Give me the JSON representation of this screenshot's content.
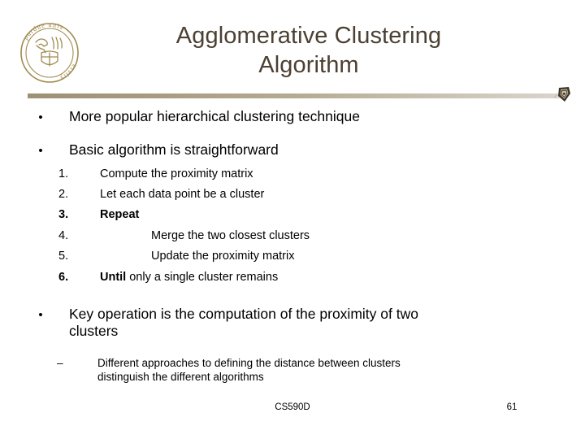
{
  "slide": {
    "title_lines": [
      "Agglomerative Clustering",
      "Algorithm"
    ],
    "title_color": "#4b4032",
    "background_color": "#ffffff",
    "divider_color_left": "#9d9173",
    "divider_color_right": "#d9d5cc"
  },
  "logo": {
    "name": "purdue-university-seal",
    "alt_text": "purdue university",
    "color": "#a08c50"
  },
  "ornament": {
    "name": "shield-ornament",
    "color": "#3b3328"
  },
  "bullets": {
    "b1": {
      "marker": "•",
      "text": "More popular hierarchical clustering technique"
    },
    "b2": {
      "marker": "•",
      "text": "Basic algorithm is straightforward"
    },
    "b3": {
      "marker": "•",
      "line1": "Key operation is the computation of the proximity of two",
      "line2": "clusters"
    },
    "sub1": {
      "marker": "–",
      "line1": "Different approaches to defining the distance between clusters",
      "line2": "distinguish the different algorithms"
    }
  },
  "algorithm_steps": [
    {
      "num": "1.",
      "text": "Compute the proximity matrix",
      "bold_lead": "",
      "deep": false,
      "bold_num": false
    },
    {
      "num": "2.",
      "text": "Let each data point be a cluster",
      "bold_lead": "",
      "deep": false,
      "bold_num": false
    },
    {
      "num": "3.",
      "text": "",
      "bold_lead": "Repeat",
      "deep": false,
      "bold_num": true
    },
    {
      "num": "4.",
      "text": "Merge the two closest clusters",
      "bold_lead": "",
      "deep": true,
      "bold_num": false
    },
    {
      "num": "5.",
      "text": "Update the proximity matrix",
      "bold_lead": "",
      "deep": true,
      "bold_num": false
    },
    {
      "num": "6.",
      "text": " only a single cluster remains",
      "bold_lead": "Until",
      "deep": false,
      "bold_num": true
    }
  ],
  "footer": {
    "course": "CS590D",
    "page_number": "61"
  }
}
